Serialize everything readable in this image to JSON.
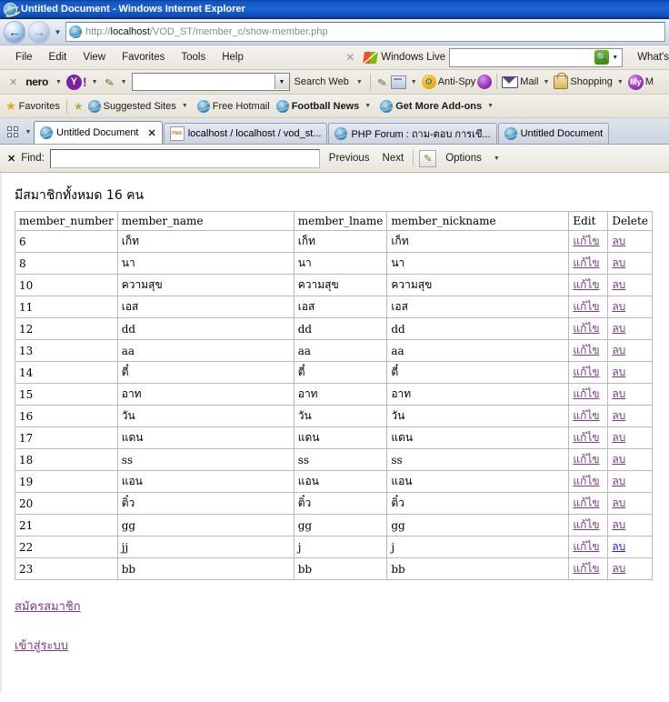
{
  "window": {
    "title": "Untitled Document - Windows Internet Explorer",
    "ie_icon": "ie-logo-icon"
  },
  "navbar": {
    "back_icon": "back-arrow-icon",
    "forward_icon": "forward-arrow-icon",
    "history_caret_icon": "chevron-down-icon",
    "address_icon": "ie-page-icon",
    "url_parts": {
      "scheme": "http://",
      "host": "localhost",
      "path": "/VOD_ST/member_c/show-member.php"
    },
    "url_full": "http://localhost/VOD_ST/member_c/show-member.php"
  },
  "menubar": {
    "items": [
      "File",
      "Edit",
      "View",
      "Favorites",
      "Tools",
      "Help"
    ],
    "close_icon": "close-x-icon",
    "windows_live_label": "Windows Live",
    "windows_live_flag_icon": "windows-flag-icon",
    "search_value": "",
    "search_placeholder": "",
    "search_go_icon": "search-icon",
    "search_caret_icon": "chevron-down-icon",
    "whats_label": "What's"
  },
  "toolbar2": {
    "close_icon": "close-x-icon",
    "nero_label": "nero",
    "yahoo_icon": "yahoo-icon",
    "yahoo_bang": "!",
    "pen_icon": "highlighter-pen-icon",
    "search_value": "",
    "search_web_label": "Search Web",
    "window_icon": "windows-stack-icon",
    "antispy_label": "Anti-Spy",
    "antispy_icon": "anti-spy-icon",
    "purple_icon": "yahoo-messenger-icon",
    "mail_label": "Mail",
    "mail_icon": "envelope-icon",
    "shopping_label": "Shopping",
    "shopping_icon": "shopping-bag-icon",
    "my_label": "My",
    "my_trailing": "M",
    "my_icon": "my-yahoo-icon",
    "caret_icon": "chevron-down-icon"
  },
  "favbar": {
    "favorites_label": "Favorites",
    "star_icon": "star-icon",
    "add_star_icon": "add-to-favorites-icon",
    "items": [
      {
        "label": "Suggested Sites",
        "icon": "ie-page-icon",
        "caret": true,
        "bold": false
      },
      {
        "label": "Free Hotmail",
        "icon": "ie-page-icon",
        "caret": false,
        "bold": false
      },
      {
        "label": "Football News",
        "icon": "ie-page-icon",
        "caret": true,
        "bold": true
      },
      {
        "label": "Get More Add-ons",
        "icon": "ie-page-icon",
        "caret": true,
        "bold": true
      }
    ]
  },
  "tabbar": {
    "quick_tabs_icon": "quick-tabs-icon",
    "tab_list_caret_icon": "chevron-down-icon",
    "tabs": [
      {
        "label": "Untitled Document",
        "icon": "ie-page-icon",
        "active": true,
        "closable": true
      },
      {
        "label": "localhost / localhost / vod_st...",
        "icon": "phpmyadmin-icon",
        "active": false,
        "closable": false
      },
      {
        "label": "PHP Forum : ถาม-ตอบ การเขี...",
        "icon": "ie-page-icon",
        "active": false,
        "closable": false
      },
      {
        "label": "Untitled Document",
        "icon": "ie-page-icon",
        "active": false,
        "closable": false
      }
    ],
    "close_icon": "close-x-icon"
  },
  "findbar": {
    "close_icon": "close-x-icon",
    "find_label": "Find:",
    "find_value": "",
    "find_placeholder": "",
    "previous_label": "Previous",
    "next_label": "Next",
    "highlight_icon": "highlighter-icon",
    "options_label": "Options",
    "options_caret_icon": "chevron-down-icon"
  },
  "page": {
    "heading": "มีสมาชิกทั้งหมด 16 คน",
    "table": {
      "headers": [
        "member_number",
        "member_name",
        "member_lname",
        "member_nickname",
        "Edit",
        "Delete"
      ],
      "edit_link_label": "แก้ไข",
      "delete_link_label": "ลบ",
      "rows": [
        {
          "number": "6",
          "name": "เก็ท",
          "lname": "เก็ท",
          "nickname": "เก็ท"
        },
        {
          "number": "8",
          "name": "นา",
          "lname": "นา",
          "nickname": "นา"
        },
        {
          "number": "10",
          "name": "ความสุข",
          "lname": "ความสุข",
          "nickname": "ความสุข"
        },
        {
          "number": "11",
          "name": "เอส",
          "lname": "เอส",
          "nickname": "เอส"
        },
        {
          "number": "12",
          "name": "dd",
          "lname": "dd",
          "nickname": "dd"
        },
        {
          "number": "13",
          "name": "aa",
          "lname": "aa",
          "nickname": "aa"
        },
        {
          "number": "14",
          "name": "ตี๋",
          "lname": "ตี๋",
          "nickname": "ตี๋"
        },
        {
          "number": "15",
          "name": "อาท",
          "lname": "อาท",
          "nickname": "อาท"
        },
        {
          "number": "16",
          "name": "วัน",
          "lname": "วัน",
          "nickname": "วัน"
        },
        {
          "number": "17",
          "name": "แดน",
          "lname": "แดน",
          "nickname": "แดน"
        },
        {
          "number": "18",
          "name": "ss",
          "lname": "ss",
          "nickname": "ss"
        },
        {
          "number": "19",
          "name": "แอน",
          "lname": "แอน",
          "nickname": "แอน"
        },
        {
          "number": "20",
          "name": "ติ๋ว",
          "lname": "ติ๋ว",
          "nickname": "ติ๋ว"
        },
        {
          "number": "21",
          "name": "gg",
          "lname": "gg",
          "nickname": "gg"
        },
        {
          "number": "22",
          "name": "jj",
          "lname": "j",
          "nickname": "j"
        },
        {
          "number": "23",
          "name": "bb",
          "lname": "bb",
          "nickname": "bb"
        }
      ]
    },
    "footer_links": [
      {
        "label": "สมัครสมาชิก"
      },
      {
        "label": "เข้าสู่ระบบ"
      }
    ]
  },
  "colors": {
    "titlebar_blue": "#1555c0",
    "visited_link": "#7a3a8a",
    "unvisited_link": "#2020cc",
    "chrome_beige": "#e9e6dd",
    "search_go_green": "#4f9e18"
  }
}
